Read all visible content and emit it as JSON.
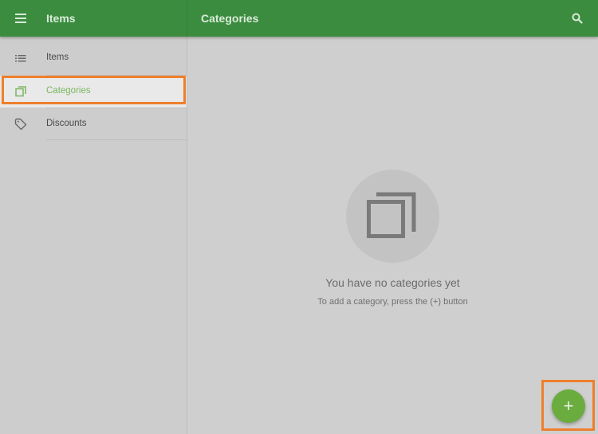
{
  "appbar": {
    "nav_title": "Items",
    "page_title": "Categories",
    "menu_icon": "hamburger-menu-icon",
    "search_icon": "search-icon"
  },
  "sidebar": {
    "items": [
      {
        "label": "Items",
        "icon": "list-icon",
        "active": false
      },
      {
        "label": "Categories",
        "icon": "categories-icon",
        "active": true
      },
      {
        "label": "Discounts",
        "icon": "tag-icon",
        "active": false
      }
    ]
  },
  "empty_state": {
    "icon": "categories-icon",
    "title": "You have no categories yet",
    "subtitle": "To add a category, press the (+) button"
  },
  "fab": {
    "label": "+",
    "icon": "add-icon"
  },
  "colors": {
    "primary": "#3c8c40",
    "accent": "#6aac3e",
    "active_text": "#7bb661",
    "highlight": "#ef7f2c"
  }
}
